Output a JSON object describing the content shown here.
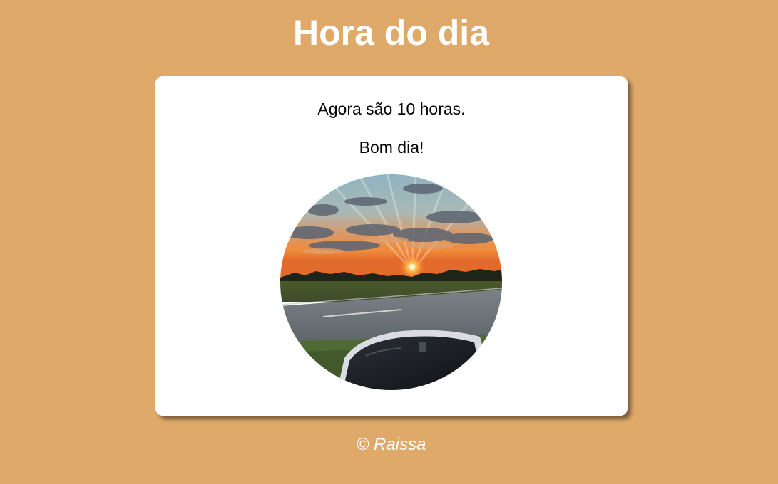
{
  "header": {
    "title": "Hora do dia"
  },
  "card": {
    "time_text": "Agora são 10 horas.",
    "greeting": "Bom dia!",
    "image": {
      "subject": "sunset-over-road-with-car-mirror"
    }
  },
  "footer": {
    "text": "© Raissa"
  },
  "colors": {
    "background": "#dfa96a",
    "card": "#ffffff",
    "title": "#ffffff"
  }
}
